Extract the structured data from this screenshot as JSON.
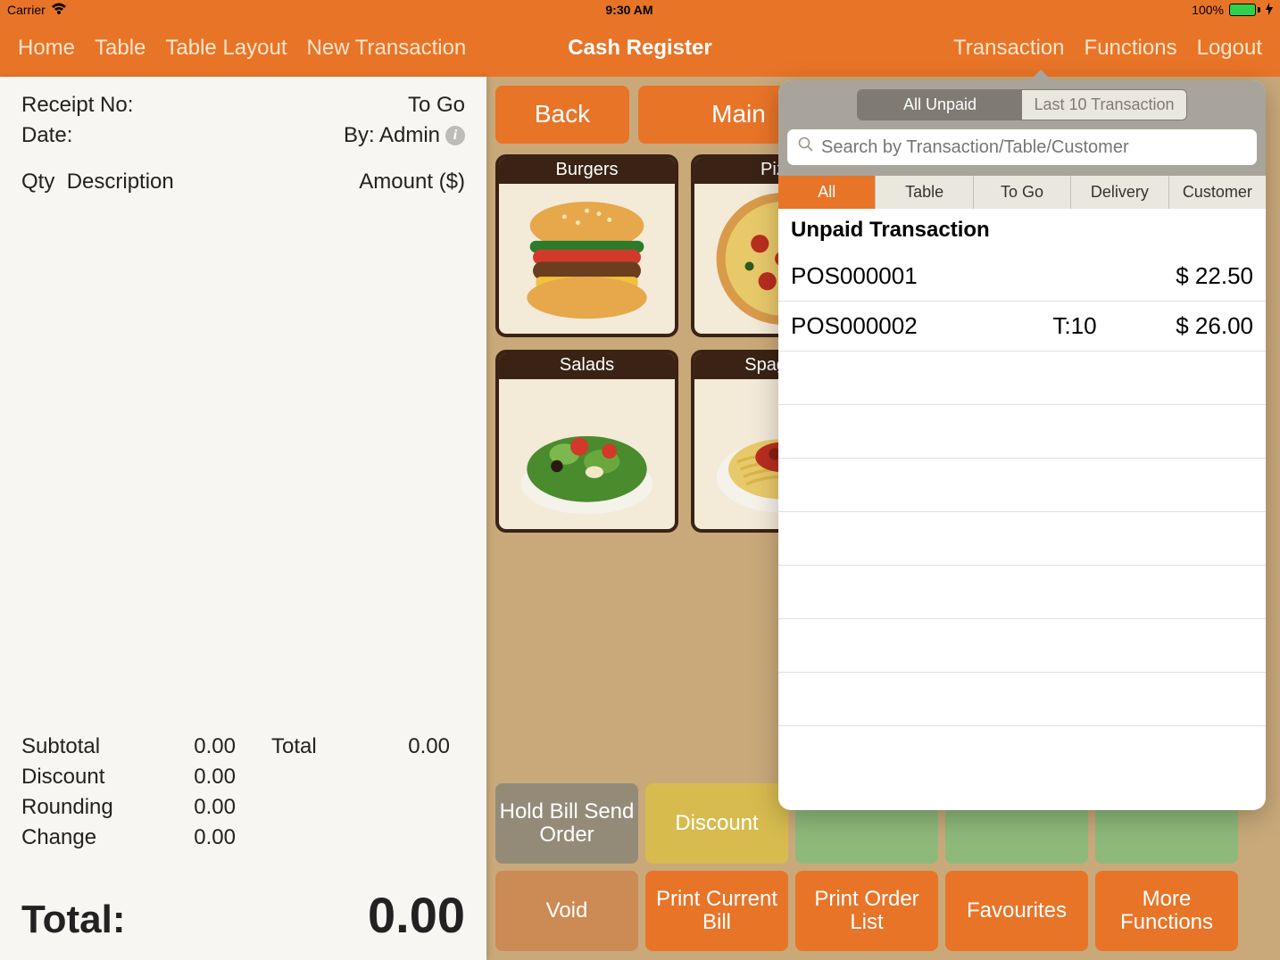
{
  "status_bar": {
    "carrier": "Carrier",
    "time": "9:30 AM",
    "battery": "100%"
  },
  "nav": {
    "left": [
      "Home",
      "Table",
      "Table Layout",
      "New Transaction"
    ],
    "title": "Cash Register",
    "right": [
      "Transaction",
      "Functions",
      "Logout"
    ]
  },
  "receipt": {
    "receipt_no_label": "Receipt No:",
    "to_go_label": "To Go",
    "date_label": "Date:",
    "by_label": "By: Admin",
    "qty_label": "Qty",
    "desc_label": "Description",
    "amount_label": "Amount ($)",
    "subtotal_label": "Subtotal",
    "subtotal_val": "0.00",
    "total_label": "Total",
    "total_val": "0.00",
    "discount_label": "Discount",
    "discount_val": "0.00",
    "rounding_label": "Rounding",
    "rounding_val": "0.00",
    "change_label": "Change",
    "change_val": "0.00",
    "grand_label": "Total:",
    "grand_val": "0.00"
  },
  "categories": {
    "back_label": "Back",
    "main_label": "Main",
    "cards": [
      "Burgers",
      "Pizza",
      "Salads",
      "Spaghetti"
    ]
  },
  "actions": {
    "hold_bill": "Hold Bill Send Order",
    "discount": "Discount",
    "void": "Void",
    "print_current": "Print Current Bill",
    "print_order": "Print Order List",
    "favourites": "Favourites",
    "more": "More Functions"
  },
  "popover": {
    "seg": [
      "All Unpaid",
      "Last 10 Transaction"
    ],
    "search_placeholder": "Search by Transaction/Table/Customer",
    "filters": [
      "All",
      "Table",
      "To Go",
      "Delivery",
      "Customer"
    ],
    "section_title": "Unpaid Transaction",
    "rows": [
      {
        "id": "POS000001",
        "mid": "",
        "amt": "$ 22.50"
      },
      {
        "id": "POS000002",
        "mid": "T:10",
        "amt": "$ 26.00"
      }
    ]
  }
}
